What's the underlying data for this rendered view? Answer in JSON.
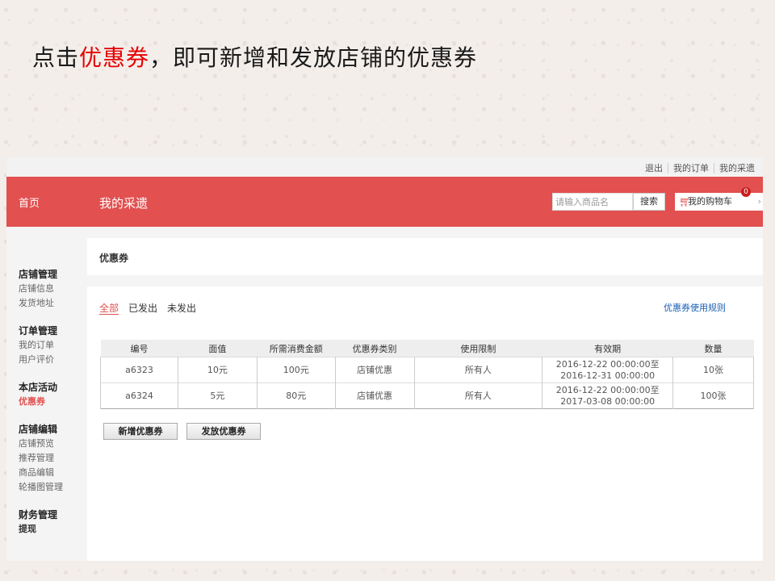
{
  "slide": {
    "title_prefix": "点击",
    "title_highlight": "优惠券",
    "title_suffix": "，即可新增和发放店铺的优惠券"
  },
  "topbar": {
    "links": [
      "退出",
      "我的订单",
      "我的采遗"
    ]
  },
  "header": {
    "home": "首页",
    "brand": "我的采遗",
    "search_placeholder": "请输入商品名",
    "search_button": "搜索",
    "cart_label": "我的购物车",
    "cart_count": "0",
    "accent_color": "#e25050"
  },
  "sidebar": {
    "groups": [
      {
        "title": "店铺管理",
        "items": [
          "店铺信息",
          "发货地址"
        ]
      },
      {
        "title": "订单管理",
        "items": [
          "我的订单",
          "用户评价"
        ]
      },
      {
        "title": "本店活动",
        "items": [
          "优惠券"
        ]
      },
      {
        "title": "店铺编辑",
        "items": [
          "店铺预览",
          "推荐管理",
          "商品编辑",
          "轮播图管理"
        ]
      },
      {
        "title": "财务管理",
        "items": [
          "提现"
        ]
      }
    ],
    "active_item": "优惠券"
  },
  "content": {
    "page_title": "优惠券",
    "tabs": [
      "全部",
      "已发出",
      "未发出"
    ],
    "active_tab": "全部",
    "rules_link": "优惠券使用规则",
    "table": {
      "headers": [
        "编号",
        "面值",
        "所需消费金额",
        "优惠券类别",
        "使用限制",
        "有效期",
        "数量"
      ],
      "rows": [
        [
          "a6323",
          "10元",
          "100元",
          "店铺优惠",
          "所有人",
          "2016-12-22 00:00:00至2016-12-31 00:00:00",
          "10张"
        ],
        [
          "a6324",
          "5元",
          "80元",
          "店铺优惠",
          "所有人",
          "2016-12-22 00:00:00至2017-03-08 00:00:00",
          "100张"
        ]
      ]
    },
    "buttons": {
      "add": "新增优惠券",
      "issue": "发放优惠券"
    }
  }
}
